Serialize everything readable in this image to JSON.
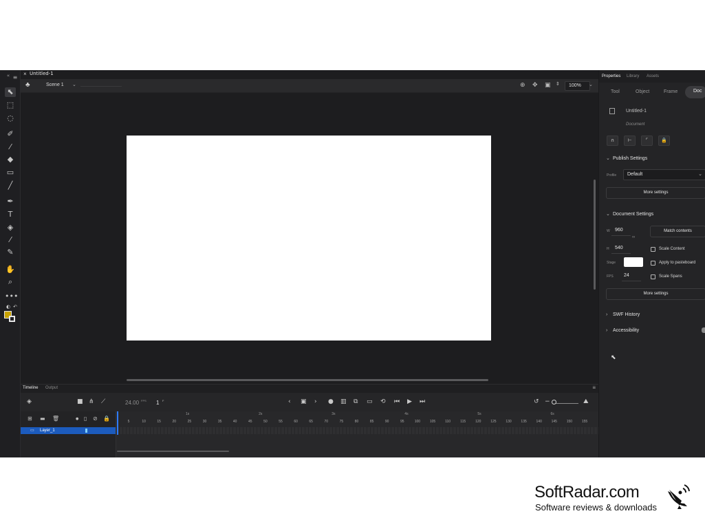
{
  "document": {
    "tab_close": "×",
    "tab_title": "Untitled-1"
  },
  "scene_bar": {
    "scene_name": "Scene 1",
    "zoom": "100%"
  },
  "timeline": {
    "tabs": [
      "Timeline",
      "Output"
    ],
    "fps": "24.00",
    "fps_unit": "FPS",
    "current_frame": "1",
    "frame_unit": "F",
    "seconds_markers": [
      "1s",
      "2s",
      "3s",
      "4s",
      "5s",
      "6s"
    ],
    "frame_numbers": [
      "5",
      "10",
      "15",
      "20",
      "25",
      "30",
      "35",
      "40",
      "45",
      "50",
      "55",
      "60",
      "65",
      "70",
      "75",
      "80",
      "85",
      "90",
      "95",
      "100",
      "105",
      "110",
      "115",
      "120",
      "125",
      "130",
      "135",
      "140",
      "145",
      "150",
      "155"
    ],
    "layer_name": "Layer_1"
  },
  "properties": {
    "panel_tabs": [
      "Properties",
      "Library",
      "Assets"
    ],
    "sub_tabs": [
      "Tool",
      "Object",
      "Frame",
      "Doc"
    ],
    "doc_name": "Untitled-1",
    "doc_type": "Document",
    "publish_settings": {
      "title": "Publish Settings",
      "profile_label": "Profile",
      "profile_value": "Default",
      "more_settings": "More settings"
    },
    "document_settings": {
      "title": "Document Settings",
      "w_label": "W",
      "w_value": "960",
      "h_label": "H",
      "h_value": "540",
      "match_contents": "Match contents",
      "scale_content": "Scale Content",
      "stage_label": "Stage",
      "stage_color": "#ffffff",
      "apply_to_pasteboard": "Apply to pasteboard",
      "fps_label": "FPS",
      "fps_value": "24",
      "scale_spans": "Scale Spans",
      "more_settings": "More settings"
    },
    "swf_history": "SWF History",
    "accessibility": "Accessibility"
  },
  "watermark": {
    "title": "SoftRadar.com",
    "subtitle": "Software reviews & downloads"
  },
  "colors": {
    "accent": "#1c5bbd",
    "playhead": "#2e7bff",
    "fill_swatch": "#c8a200"
  }
}
